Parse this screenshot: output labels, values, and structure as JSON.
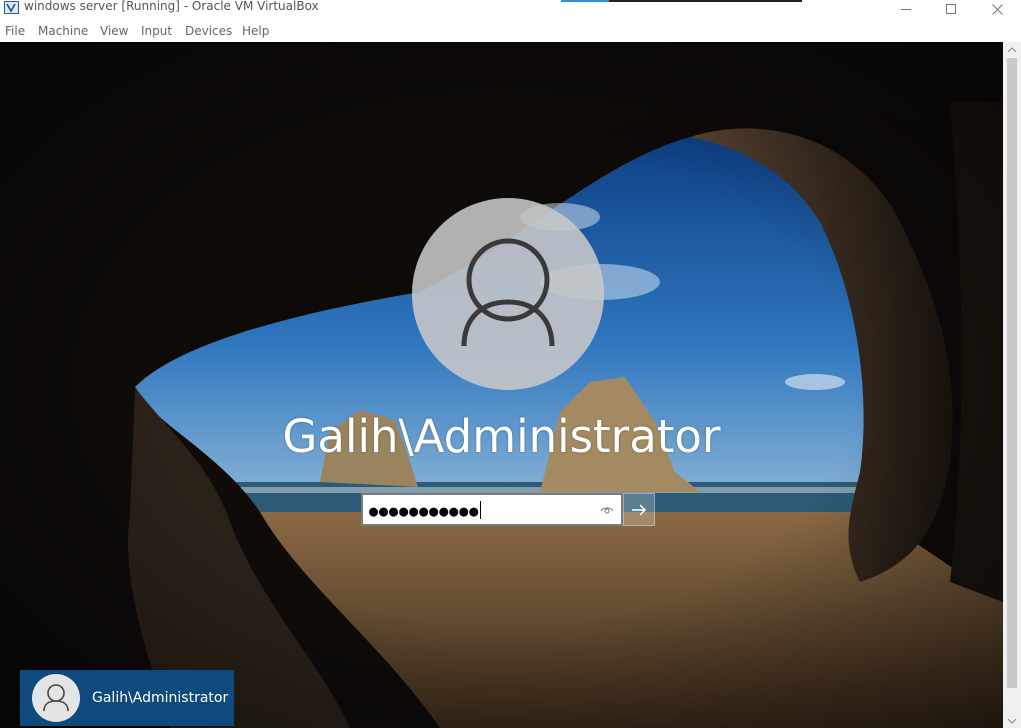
{
  "window": {
    "title": "windows server [Running] - Oracle VM VirtualBox"
  },
  "menu": [
    "File",
    "Machine",
    "View",
    "Input",
    "Devices",
    "Help"
  ],
  "login": {
    "username": "Galih\\Administrator",
    "password_masked": "●●●●●●●●●●●",
    "reveal_icon": "eye-icon",
    "submit_icon": "arrow-right-icon"
  },
  "user_tile": {
    "name": "Galih\\Administrator"
  },
  "colors": {
    "tile_bg": "#0e4a7e",
    "avatar_bg": "#c8c8c8"
  }
}
